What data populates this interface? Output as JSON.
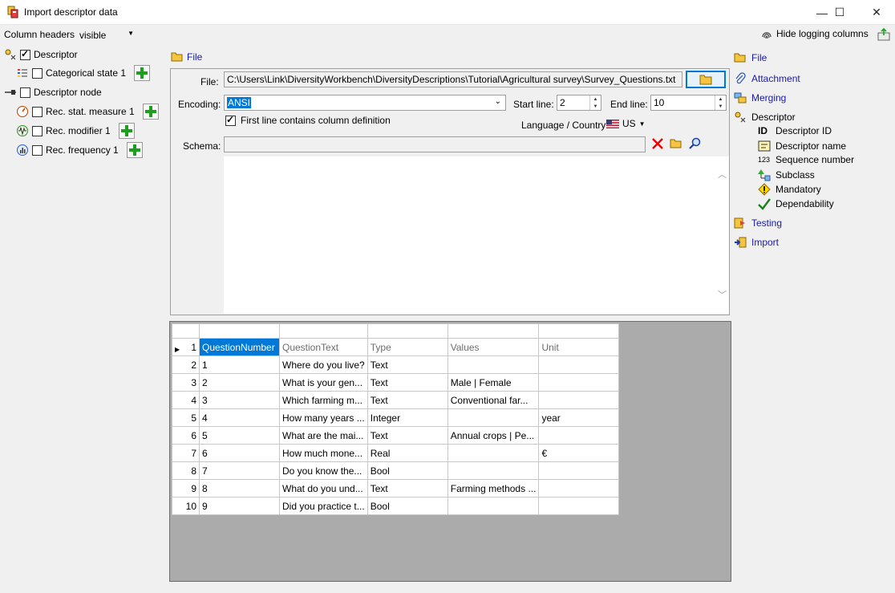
{
  "window": {
    "title": "Import descriptor data",
    "minimize_label": "—",
    "maximize_label": "☐",
    "close_label": "✕"
  },
  "topbar": {
    "column_headers_label": "Column headers",
    "column_headers_value": "visible",
    "hide_logging_label": "Hide logging columns"
  },
  "tree": {
    "descriptor_label": "Descriptor",
    "descriptor_checked": true,
    "categorical_state_label": "Categorical state 1",
    "descriptor_node_label": "Descriptor node",
    "rec_stat_measure_label": "Rec. stat. measure 1",
    "rec_modifier_label": "Rec. modifier 1",
    "rec_frequency_label": "Rec. frequency 1"
  },
  "file_section": {
    "title": "File",
    "file_label": "File:",
    "file_path": "C:\\Users\\Link\\DiversityWorkbench\\DiversityDescriptions\\Tutorial\\Agricultural survey\\Survey_Questions.txt",
    "encoding_label": "Encoding:",
    "encoding_value": "ANSI",
    "start_line_label": "Start line:",
    "start_line_value": "2",
    "end_line_label": "End line:",
    "end_line_value": "10",
    "first_line_label": "First line contains column definition",
    "first_line_checked": true,
    "language_label": "Language / Country:",
    "language_value": "US",
    "schema_label": "Schema:",
    "schema_value": ""
  },
  "grid": {
    "columns": [
      "QuestionNumber",
      "QuestionText",
      "Type",
      "Values",
      "Unit"
    ],
    "rows": [
      {
        "num": "2",
        "cells": [
          "1",
          "Where do you live?",
          "Text",
          "",
          ""
        ]
      },
      {
        "num": "3",
        "cells": [
          "2",
          "What is your gen...",
          "Text",
          "Male | Female",
          ""
        ]
      },
      {
        "num": "4",
        "cells": [
          "3",
          "Which farming m...",
          "Text",
          "Conventional far...",
          ""
        ]
      },
      {
        "num": "5",
        "cells": [
          "4",
          "How many years ...",
          "Integer",
          "",
          "year"
        ]
      },
      {
        "num": "6",
        "cells": [
          "5",
          "What are the mai...",
          "Text",
          "Annual crops | Pe...",
          ""
        ]
      },
      {
        "num": "7",
        "cells": [
          "6",
          "How much mone...",
          "Real",
          "",
          "€"
        ]
      },
      {
        "num": "8",
        "cells": [
          "7",
          "Do you know the...",
          "Bool",
          "",
          ""
        ]
      },
      {
        "num": "9",
        "cells": [
          "8",
          "What do you und...",
          "Text",
          "Farming methods ...",
          ""
        ]
      },
      {
        "num": "10",
        "cells": [
          "9",
          "Did you practice t...",
          "Bool",
          "",
          ""
        ]
      }
    ],
    "header_row_num": "1",
    "current_row_marker": "▶"
  },
  "right_nav": {
    "file": "File",
    "attachment": "Attachment",
    "merging": "Merging",
    "descriptor": "Descriptor",
    "descriptor_id": "Descriptor ID",
    "descriptor_name": "Descriptor name",
    "sequence_number": "Sequence number",
    "subclass": "Subclass",
    "mandatory": "Mandatory",
    "dependability": "Dependability",
    "testing": "Testing",
    "import": "Import",
    "id_glyph": "ID",
    "seq_glyph": "123"
  },
  "colors": {
    "link": "#1a1aa6",
    "selection": "#0078d7",
    "grid_bg": "#ababab",
    "plus_green": "#1e9e1e"
  }
}
